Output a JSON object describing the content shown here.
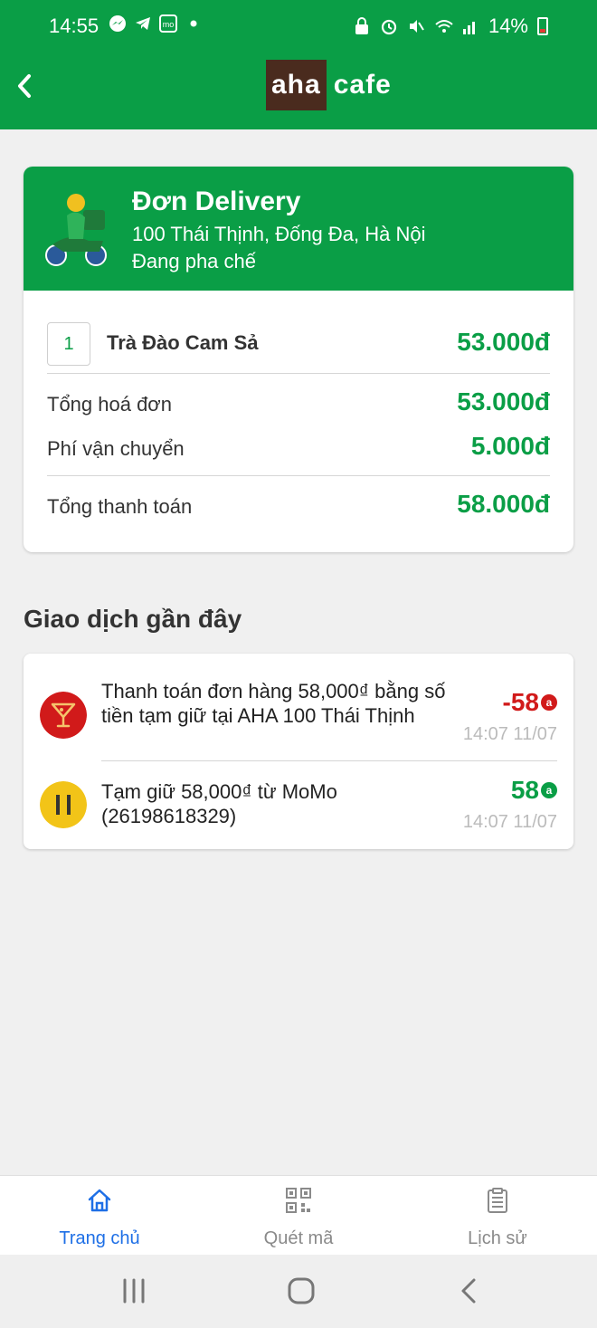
{
  "status_bar": {
    "time": "14:55",
    "battery": "14%"
  },
  "header": {
    "logo_left": "aha",
    "logo_right": "cafe"
  },
  "order": {
    "title": "Đơn Delivery",
    "address": "100 Thái Thịnh, Đống Đa, Hà Nội",
    "status": "Đang pha chế",
    "item": {
      "qty": "1",
      "name": "Trà Đào Cam Sả",
      "price": "53.000đ"
    },
    "subtotal_label": "Tổng hoá đơn",
    "subtotal": "53.000đ",
    "shipping_label": "Phí vận chuyển",
    "shipping": "5.000đ",
    "total_label": "Tổng thanh toán",
    "total": "58.000đ"
  },
  "recent": {
    "title": "Giao dịch gần đây",
    "transactions": [
      {
        "text": "Thanh toán đơn hàng 58,000₫ bằng số tiền tạm giữ tại AHA 100 Thái Thịnh",
        "amount": "-58",
        "time": "14:07 11/07",
        "color": "#d11a1a",
        "coin": "a",
        "icon": "cocktail-icon"
      },
      {
        "text": "Tạm giữ 58,000₫ từ MoMo (26198618329)",
        "amount": "58",
        "time": "14:07 11/07",
        "color": "#0a9e46",
        "coin": "a",
        "icon": "pause-icon"
      }
    ]
  },
  "bottom_nav": {
    "items": [
      {
        "label": "Trang chủ",
        "icon": "home-icon",
        "active": true
      },
      {
        "label": "Quét mã",
        "icon": "qr-code-icon",
        "active": false
      },
      {
        "label": "Lịch sử",
        "icon": "clipboard-icon",
        "active": false
      }
    ]
  },
  "colors": {
    "brand": "#0a9e46",
    "active_nav": "#1e6fe6",
    "negative": "#d11a1a"
  }
}
